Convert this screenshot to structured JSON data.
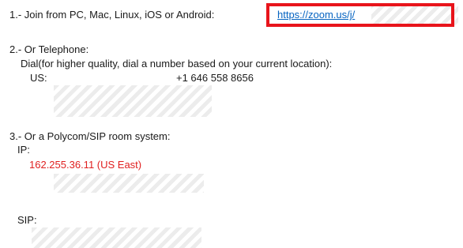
{
  "section1": {
    "label": "1.- Join from PC, Mac, Linux, iOS or Android:",
    "link_text": "https://zoom.us/j/"
  },
  "section2": {
    "heading": "2.- Or Telephone:",
    "dial_note": "Dial(for higher quality, dial a number based on your current location):",
    "us_label": "US:",
    "phone_number": "+1 646 558 8656"
  },
  "section3": {
    "heading": "3.- Or a Polycom/SIP room system:",
    "ip_label": "IP:",
    "ip_value": "162.255.36.11 (US East)",
    "sip_label": "SIP:"
  },
  "colors": {
    "link": "#0563c1",
    "highlight_border": "#e8141b",
    "ip_text": "#e02020"
  }
}
